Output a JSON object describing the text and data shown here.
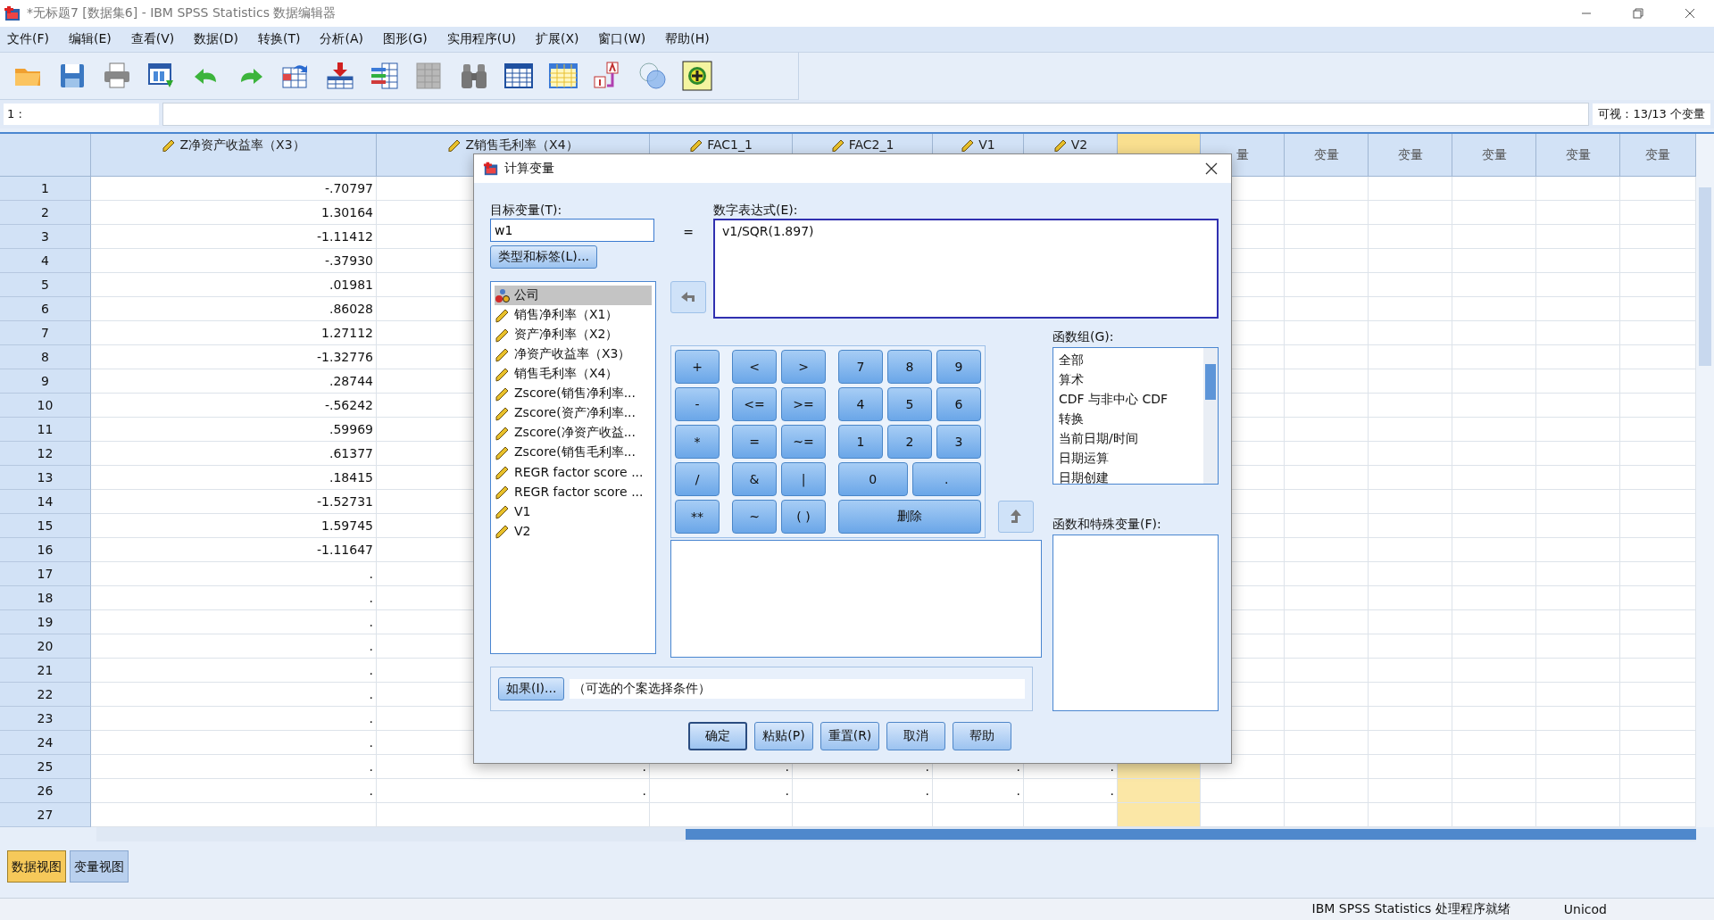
{
  "window": {
    "title": "*无标题7 [数据集6] - IBM SPSS Statistics 数据编辑器"
  },
  "menu": [
    "文件(F)",
    "编辑(E)",
    "查看(V)",
    "数据(D)",
    "转换(T)",
    "分析(A)",
    "图形(G)",
    "实用程序(U)",
    "扩展(X)",
    "窗口(W)",
    "帮助(H)"
  ],
  "cell_bar": {
    "cell_ref": "1 :",
    "visible_vars": "可视：13/13 个变量"
  },
  "grid": {
    "columns": [
      {
        "label": "Z净资产收益率（X3）",
        "kind": "scale",
        "selected": false
      },
      {
        "label": "Z销售毛利率（X4）",
        "kind": "scale",
        "selected": false
      },
      {
        "label": "FAC1_1",
        "kind": "scale",
        "selected": false
      },
      {
        "label": "FAC2_1",
        "kind": "scale",
        "selected": false
      },
      {
        "label": "V1",
        "kind": "scale",
        "selected": false
      },
      {
        "label": "V2",
        "kind": "scale",
        "selected": false
      },
      {
        "kind": "empty",
        "selected": true
      },
      {
        "label": "量",
        "kind": "empty",
        "selected": false
      },
      {
        "label": "变量",
        "kind": "empty",
        "selected": false
      },
      {
        "label": "变量",
        "kind": "empty",
        "selected": false
      },
      {
        "label": "变量",
        "kind": "empty",
        "selected": false
      },
      {
        "label": "变量",
        "kind": "empty",
        "selected": false
      },
      {
        "label": "变量",
        "kind": "empty",
        "selected": false
      }
    ],
    "rows": [
      {
        "num": "1",
        "cells": [
          "-.70797"
        ]
      },
      {
        "num": "2",
        "cells": [
          "1.30164"
        ]
      },
      {
        "num": "3",
        "cells": [
          "-1.11412"
        ]
      },
      {
        "num": "4",
        "cells": [
          "-.37930"
        ]
      },
      {
        "num": "5",
        "cells": [
          ".01981"
        ]
      },
      {
        "num": "6",
        "cells": [
          ".86028"
        ]
      },
      {
        "num": "7",
        "cells": [
          "1.27112"
        ]
      },
      {
        "num": "8",
        "cells": [
          "-1.32776"
        ]
      },
      {
        "num": "9",
        "cells": [
          ".28744"
        ]
      },
      {
        "num": "10",
        "cells": [
          "-.56242"
        ]
      },
      {
        "num": "11",
        "cells": [
          ".59969"
        ]
      },
      {
        "num": "12",
        "cells": [
          ".61377"
        ]
      },
      {
        "num": "13",
        "cells": [
          ".18415"
        ]
      },
      {
        "num": "14",
        "cells": [
          "-1.52731"
        ]
      },
      {
        "num": "15",
        "cells": [
          "1.59745"
        ]
      },
      {
        "num": "16",
        "cells": [
          "-1.11647"
        ]
      },
      {
        "num": "17",
        "cells": [
          "."
        ]
      },
      {
        "num": "18",
        "cells": [
          "."
        ]
      },
      {
        "num": "19",
        "cells": [
          "."
        ]
      },
      {
        "num": "20",
        "cells": [
          "."
        ]
      },
      {
        "num": "21",
        "cells": [
          "."
        ]
      },
      {
        "num": "22",
        "cells": [
          "."
        ]
      },
      {
        "num": "23",
        "cells": [
          "."
        ]
      },
      {
        "num": "24",
        "cells": [
          "."
        ]
      },
      {
        "num": "25",
        "cells": [
          ".",
          ".",
          ".",
          ".",
          ".",
          "."
        ]
      },
      {
        "num": "26",
        "cells": [
          ".",
          ".",
          ".",
          ".",
          ".",
          "."
        ]
      },
      {
        "num": "27",
        "cells": []
      }
    ]
  },
  "dialog": {
    "title": "计算变量",
    "target_label": "目标变量(T):",
    "target_value": "w1",
    "type_button": "类型和标签(L)...",
    "variables": [
      {
        "name": "公司",
        "kind": "nominal",
        "selected": true
      },
      {
        "name": "销售净利率（X1）",
        "kind": "scale",
        "selected": false
      },
      {
        "name": "资产净利率（X2）",
        "kind": "scale",
        "selected": false
      },
      {
        "name": "净资产收益率（X3）",
        "kind": "scale",
        "selected": false
      },
      {
        "name": "销售毛利率（X4）",
        "kind": "scale",
        "selected": false
      },
      {
        "name": "Zscore(销售净利率...",
        "kind": "scale",
        "selected": false
      },
      {
        "name": "Zscore(资产净利率...",
        "kind": "scale",
        "selected": false
      },
      {
        "name": "Zscore(净资产收益...",
        "kind": "scale",
        "selected": false
      },
      {
        "name": "Zscore(销售毛利率...",
        "kind": "scale",
        "selected": false
      },
      {
        "name": "REGR factor score ...",
        "kind": "scale",
        "selected": false
      },
      {
        "name": "REGR factor score ...",
        "kind": "scale",
        "selected": false
      },
      {
        "name": "V1",
        "kind": "scale",
        "selected": false
      },
      {
        "name": "V2",
        "kind": "scale",
        "selected": false
      }
    ],
    "equals": "=",
    "expression_label": "数字表达式(E):",
    "expression": "v1/SQR(1.897)",
    "keypad": [
      [
        [
          "+"
        ],
        [
          "<",
          ">"
        ],
        [
          "7",
          "8",
          "9"
        ]
      ],
      [
        [
          "-"
        ],
        [
          "<=",
          ">="
        ],
        [
          "4",
          "5",
          "6"
        ]
      ],
      [
        [
          "*"
        ],
        [
          "=",
          "~="
        ],
        [
          "1",
          "2",
          "3"
        ]
      ],
      [
        [
          "/"
        ],
        [
          "&",
          "|"
        ],
        [
          "0",
          "."
        ]
      ],
      [
        [
          "**"
        ],
        [
          "~",
          "( )"
        ],
        [
          "删除"
        ]
      ]
    ],
    "function_group_label": "函数组(G):",
    "function_groups": [
      "全部",
      "算术",
      "CDF 与非中心 CDF",
      "转换",
      "当前日期/时间",
      "日期运算",
      "日期创建"
    ],
    "functions_label": "函数和特殊变量(F):",
    "if_button": "如果(I)...",
    "if_condition": "（可选的个案选择条件）",
    "buttons": [
      {
        "label": "确定",
        "default": true
      },
      {
        "label": "粘贴(P)",
        "default": false
      },
      {
        "label": "重置(R)",
        "default": false
      },
      {
        "label": "取消",
        "default": false
      },
      {
        "label": "帮助",
        "default": false
      }
    ]
  },
  "tabs": [
    {
      "label": "数据视图",
      "selected": true
    },
    {
      "label": "变量视图",
      "selected": false
    }
  ],
  "status_bar": [
    "IBM SPSS Statistics 处理程序就绪",
    "Unicod"
  ]
}
